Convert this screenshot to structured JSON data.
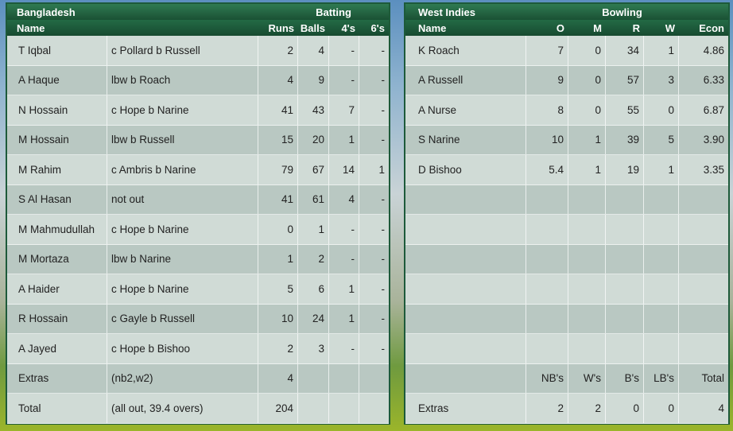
{
  "batting": {
    "team": "Bangladesh",
    "section": "Batting",
    "columns": {
      "name": "Name",
      "runs": "Runs",
      "balls": "Balls",
      "fours": "4's",
      "sixes": "6's"
    },
    "rows": [
      {
        "name": "T Iqbal",
        "how": "c Pollard b Russell",
        "runs": "2",
        "balls": "4",
        "fours": "-",
        "sixes": "-"
      },
      {
        "name": "A Haque",
        "how": "lbw b Roach",
        "runs": "4",
        "balls": "9",
        "fours": "-",
        "sixes": "-"
      },
      {
        "name": "N Hossain",
        "how": "c Hope b Narine",
        "runs": "41",
        "balls": "43",
        "fours": "7",
        "sixes": "-"
      },
      {
        "name": "M Hossain",
        "how": "lbw b Russell",
        "runs": "15",
        "balls": "20",
        "fours": "1",
        "sixes": "-"
      },
      {
        "name": "M Rahim",
        "how": "c Ambris b Narine",
        "runs": "79",
        "balls": "67",
        "fours": "14",
        "sixes": "1"
      },
      {
        "name": "S Al Hasan",
        "how": "not out",
        "runs": "41",
        "balls": "61",
        "fours": "4",
        "sixes": "-"
      },
      {
        "name": "M Mahmudullah",
        "how": "c Hope b Narine",
        "runs": "0",
        "balls": "1",
        "fours": "-",
        "sixes": "-"
      },
      {
        "name": "M Mortaza",
        "how": "lbw b Narine",
        "runs": "1",
        "balls": "2",
        "fours": "-",
        "sixes": "-"
      },
      {
        "name": "A Haider",
        "how": "c Hope b Narine",
        "runs": "5",
        "balls": "6",
        "fours": "1",
        "sixes": "-"
      },
      {
        "name": "R Hossain",
        "how": "c Gayle b Russell",
        "runs": "10",
        "balls": "24",
        "fours": "1",
        "sixes": "-"
      },
      {
        "name": "A Jayed",
        "how": "c Hope b Bishoo",
        "runs": "2",
        "balls": "3",
        "fours": "-",
        "sixes": "-"
      },
      {
        "name": "Extras",
        "how": "(nb2,w2)",
        "runs": "4",
        "balls": "",
        "fours": "",
        "sixes": ""
      },
      {
        "name": "Total",
        "how": "(all out, 39.4 overs)",
        "runs": "204",
        "balls": "",
        "fours": "",
        "sixes": ""
      }
    ]
  },
  "bowling": {
    "team": "West Indies",
    "section": "Bowling",
    "columns": {
      "name": "Name",
      "overs": "O",
      "maidens": "M",
      "runs": "R",
      "wickets": "W",
      "econ": "Econ"
    },
    "rows": [
      {
        "name": "K Roach",
        "overs": "7",
        "maidens": "0",
        "runs": "34",
        "wickets": "1",
        "econ": "4.86"
      },
      {
        "name": "A Russell",
        "overs": "9",
        "maidens": "0",
        "runs": "57",
        "wickets": "3",
        "econ": "6.33"
      },
      {
        "name": "A Nurse",
        "overs": "8",
        "maidens": "0",
        "runs": "55",
        "wickets": "0",
        "econ": "6.87"
      },
      {
        "name": "S Narine",
        "overs": "10",
        "maidens": "1",
        "runs": "39",
        "wickets": "5",
        "econ": "3.90"
      },
      {
        "name": "D Bishoo",
        "overs": "5.4",
        "maidens": "1",
        "runs": "19",
        "wickets": "1",
        "econ": "3.35"
      },
      {
        "name": "",
        "overs": "",
        "maidens": "",
        "runs": "",
        "wickets": "",
        "econ": ""
      },
      {
        "name": "",
        "overs": "",
        "maidens": "",
        "runs": "",
        "wickets": "",
        "econ": ""
      },
      {
        "name": "",
        "overs": "",
        "maidens": "",
        "runs": "",
        "wickets": "",
        "econ": ""
      },
      {
        "name": "",
        "overs": "",
        "maidens": "",
        "runs": "",
        "wickets": "",
        "econ": ""
      },
      {
        "name": "",
        "overs": "",
        "maidens": "",
        "runs": "",
        "wickets": "",
        "econ": ""
      },
      {
        "name": "",
        "overs": "",
        "maidens": "",
        "runs": "",
        "wickets": "",
        "econ": ""
      }
    ],
    "extras_header": {
      "nb": "NB's",
      "w": "W's",
      "b": "B's",
      "lb": "LB's",
      "total": "Total"
    },
    "extras": {
      "label": "Extras",
      "nb": "2",
      "w": "2",
      "b": "0",
      "lb": "0",
      "total": "4"
    }
  }
}
